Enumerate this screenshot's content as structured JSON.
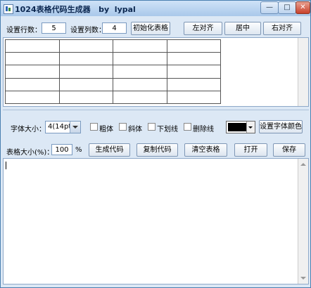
{
  "window": {
    "title": "1024表格代码生成器   by  lypal",
    "minimize_glyph": "—",
    "maximize_glyph": "□",
    "close_glyph": "✕"
  },
  "row_settings": {
    "rows_label": "设置行数：",
    "rows_value": "5",
    "cols_label": "设置列数：",
    "cols_value": "4",
    "init_button": "初始化表格",
    "align_left": "左对齐",
    "align_center": "居中",
    "align_right": "右对齐"
  },
  "grid": {
    "rows": 5,
    "cols": 4
  },
  "font": {
    "size_label": "字体大小：",
    "size_value": "4(14pt)",
    "bold_label": "粗体",
    "italic_label": "斜体",
    "underline_label": "下划线",
    "strikethrough_label": "删除线",
    "color": "#000000",
    "set_color_button": "设置字体颜色"
  },
  "table_size": {
    "label": "表格大小(%)：",
    "value": "100",
    "unit": "%",
    "generate_button": "生成代码",
    "copy_button": "复制代码",
    "clear_button": "清空表格",
    "open_button": "打开",
    "save_button": "保存"
  },
  "editor": {
    "content": ""
  }
}
